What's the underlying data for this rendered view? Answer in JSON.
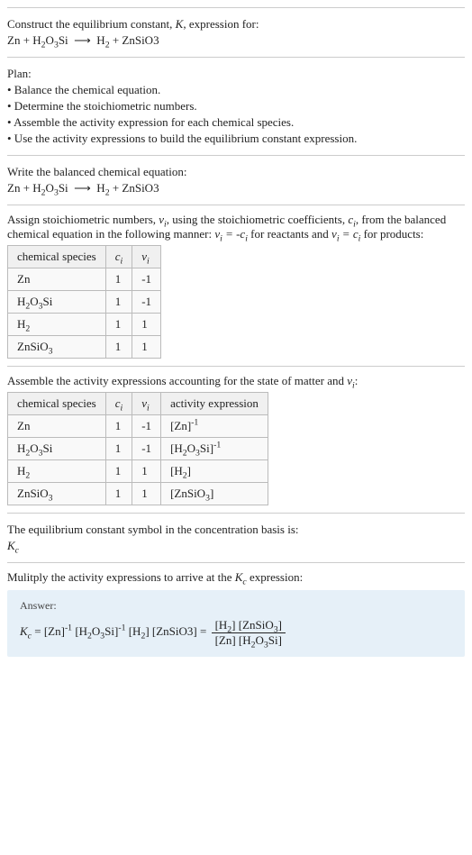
{
  "intro": {
    "prompt": "Construct the equilibrium constant, ",
    "prompt2": ", expression for:",
    "equation": "Zn + H₂O₃Si ⟶ H₂ + ZnSiO3"
  },
  "plan": {
    "heading": "Plan:",
    "items": [
      "• Balance the chemical equation.",
      "• Determine the stoichiometric numbers.",
      "• Assemble the activity expression for each chemical species.",
      "• Use the activity expressions to build the equilibrium constant expression."
    ]
  },
  "balanced": {
    "heading": "Write the balanced chemical equation:",
    "equation": "Zn + H₂O₃Si ⟶ H₂ + ZnSiO3"
  },
  "assign": {
    "text1": "Assign stoichiometric numbers, ",
    "text2": ", using the stoichiometric coefficients, ",
    "text3": ", from the balanced chemical equation in the following manner: ",
    "text4": " for reactants and ",
    "text5": " for products:",
    "headers": [
      "chemical species",
      "cᵢ",
      "νᵢ"
    ],
    "rows": [
      {
        "s": "Zn",
        "c": "1",
        "v": "-1"
      },
      {
        "s": "H₂O₃Si",
        "c": "1",
        "v": "-1"
      },
      {
        "s": "H₂",
        "c": "1",
        "v": "1"
      },
      {
        "s": "ZnSiO₃",
        "c": "1",
        "v": "1"
      }
    ]
  },
  "activity": {
    "heading": "Assemble the activity expressions accounting for the state of matter and ",
    "heading2": ":",
    "headers": [
      "chemical species",
      "cᵢ",
      "νᵢ",
      "activity expression"
    ],
    "rows": [
      {
        "s": "Zn",
        "c": "1",
        "v": "-1",
        "a": "[Zn]⁻¹"
      },
      {
        "s": "H₂O₃Si",
        "c": "1",
        "v": "-1",
        "a": "[H₂O₃Si]⁻¹"
      },
      {
        "s": "H₂",
        "c": "1",
        "v": "1",
        "a": "[H₂]"
      },
      {
        "s": "ZnSiO₃",
        "c": "1",
        "v": "1",
        "a": "[ZnSiO₃]"
      }
    ]
  },
  "symbol": {
    "text": "The equilibrium constant symbol in the concentration basis is:",
    "val": "K_c"
  },
  "multiply": {
    "heading": "Mulitply the activity expressions to arrive at the ",
    "heading2": " expression:"
  },
  "answer": {
    "label": "Answer:",
    "lhs_prefix": " = [Zn]⁻¹ [H₂O₃Si]⁻¹ [H₂] [ZnSiO3] = ",
    "num": "[H₂] [ZnSiO₃]",
    "den": "[Zn] [H₂O₃Si]"
  },
  "chart_data": {
    "type": "table",
    "tables": [
      {
        "title": "Stoichiometric numbers",
        "columns": [
          "chemical species",
          "c_i",
          "ν_i"
        ],
        "rows": [
          [
            "Zn",
            1,
            -1
          ],
          [
            "H2O3Si",
            1,
            -1
          ],
          [
            "H2",
            1,
            1
          ],
          [
            "ZnSiO3",
            1,
            1
          ]
        ]
      },
      {
        "title": "Activity expressions",
        "columns": [
          "chemical species",
          "c_i",
          "ν_i",
          "activity expression"
        ],
        "rows": [
          [
            "Zn",
            1,
            -1,
            "[Zn]^-1"
          ],
          [
            "H2O3Si",
            1,
            -1,
            "[H2O3Si]^-1"
          ],
          [
            "H2",
            1,
            1,
            "[H2]"
          ],
          [
            "ZnSiO3",
            1,
            1,
            "[ZnSiO3]"
          ]
        ]
      }
    ]
  }
}
